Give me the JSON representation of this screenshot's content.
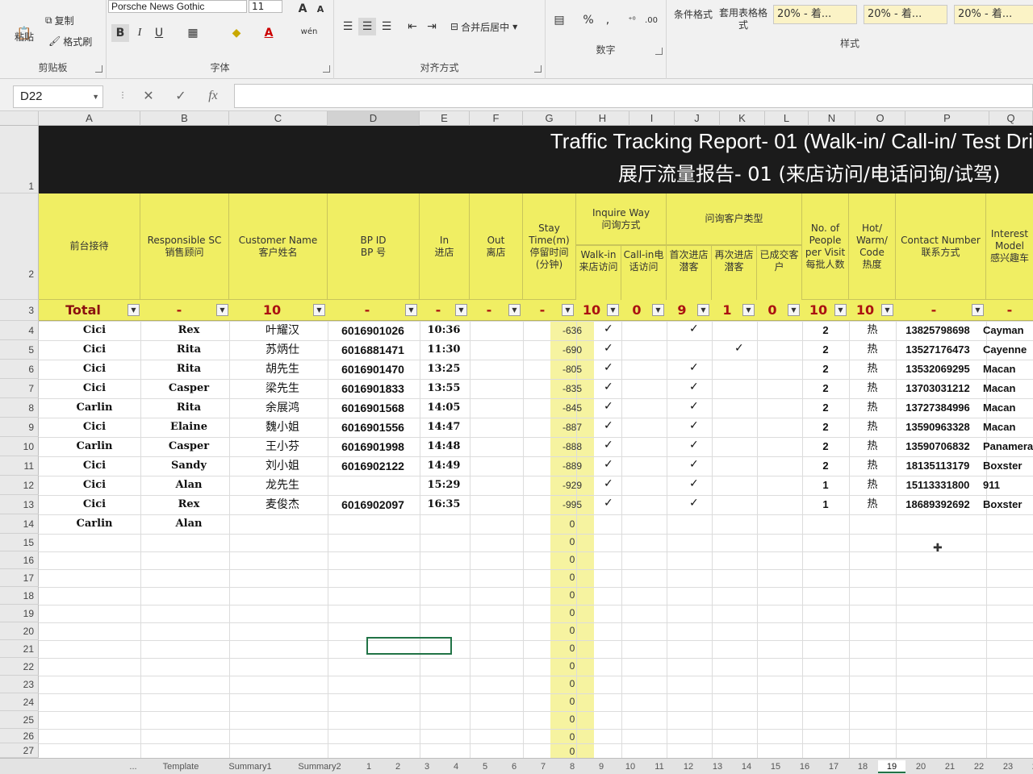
{
  "ribbon": {
    "clipboard": {
      "paste": "粘贴",
      "copy": "复制",
      "format_painter": "格式刷",
      "label": "剪贴板"
    },
    "font": {
      "name": "Porsche News Gothic",
      "size": "11",
      "label": "字体",
      "bold": "B",
      "italic": "I",
      "underline": "U",
      "font_color": "A",
      "phonetic": "wén"
    },
    "alignment": {
      "merge_center": "合并后居中",
      "label": "对齐方式"
    },
    "number": {
      "label": "数字",
      "percent": "%",
      "comma": ","
    },
    "styles": {
      "conditional": "条件格式",
      "table_format": "套用表格格式",
      "label": "样式",
      "swatches": [
        "20% - 着...",
        "20% - 着...",
        "20% - 着..."
      ]
    }
  },
  "formula_bar": {
    "name_box": "D22",
    "cancel": "✕",
    "enter": "✓",
    "fx": "fx",
    "value": ""
  },
  "columns": [
    "A",
    "B",
    "C",
    "D",
    "E",
    "F",
    "G",
    "H",
    "I",
    "J",
    "K",
    "L",
    "N",
    "O",
    "P",
    "Q"
  ],
  "row_numbers": [
    "1",
    "2",
    "3",
    "4",
    "5",
    "6",
    "7",
    "8",
    "9",
    "10",
    "11",
    "12",
    "13",
    "14",
    "15",
    "16",
    "17",
    "18",
    "19",
    "20",
    "21",
    "22",
    "23",
    "24",
    "25",
    "26",
    "27"
  ],
  "report": {
    "title_en": "Traffic Tracking Report- 01 (Walk-in/ Call-in/ Test Dri",
    "title_cn": "展厅流量报告- 01 (来店访问/电话问询/试驾)"
  },
  "headers": {
    "reception": "前台接待",
    "sc_en": "Responsible SC",
    "sc_cn": "销售顾问",
    "customer_en": "Customer Name",
    "customer_cn": "客户姓名",
    "bp_en": "BP ID",
    "bp_cn": "BP 号",
    "in_en": "In",
    "in_cn": "进店",
    "out_en": "Out",
    "out_cn": "离店",
    "stay_en": "Stay Time(m)",
    "stay_cn": "停留时间 (分钟)",
    "inquire_en": "Inquire Way",
    "inquire_cn": "问询方式",
    "walkin": "Walk-in 来店访问",
    "callin": "Call-in电话访问",
    "type_cn": "问询客户类型",
    "first_visit": "首次进店潜客",
    "revisit": "再次进店潜客",
    "closed": "已成交客户",
    "people_en": "No. of People per Visit",
    "people_cn": "每批人数",
    "hot_en": "Hot/ Warm/ Code",
    "hot_cn": "热度",
    "contact_en": "Contact Number",
    "contact_cn": "联系方式",
    "interest_en": "Interest Model",
    "interest_cn": "感兴趣车"
  },
  "filters": {
    "total": "Total",
    "b": "-",
    "c": "10",
    "d": "-",
    "e": "-",
    "f": "-",
    "g": "-",
    "h": "10",
    "i": "0",
    "j": "9",
    "k": "1",
    "l": "0",
    "n": "10",
    "o": "10",
    "p": "-",
    "q": "-"
  },
  "rows": [
    {
      "reception": "Cici",
      "sc": "Rex",
      "customer": "叶耀汉",
      "bp": "6016901026",
      "in": "10:36",
      "stay": "-636",
      "walkin": "✓",
      "first": "✓",
      "revisit": "",
      "people": "2",
      "hot": "热",
      "phone": "13825798698",
      "model": "Cayman"
    },
    {
      "reception": "Cici",
      "sc": "Rita",
      "customer": "苏炳仕",
      "bp": "6016881471",
      "in": "11:30",
      "stay": "-690",
      "walkin": "✓",
      "first": "",
      "revisit": "✓",
      "people": "2",
      "hot": "热",
      "phone": "13527176473",
      "model": "Cayenne"
    },
    {
      "reception": "Cici",
      "sc": "Rita",
      "customer": "胡先生",
      "bp": "6016901470",
      "in": "13:25",
      "stay": "-805",
      "walkin": "✓",
      "first": "✓",
      "revisit": "",
      "people": "2",
      "hot": "热",
      "phone": "13532069295",
      "model": "Macan"
    },
    {
      "reception": "Cici",
      "sc": "Casper",
      "customer": "梁先生",
      "bp": "6016901833",
      "in": "13:55",
      "stay": "-835",
      "walkin": "✓",
      "first": "✓",
      "revisit": "",
      "people": "2",
      "hot": "热",
      "phone": "13703031212",
      "model": "Macan"
    },
    {
      "reception": "Carlin",
      "sc": "Rita",
      "customer": "余展鸿",
      "bp": "6016901568",
      "in": "14:05",
      "stay": "-845",
      "walkin": "✓",
      "first": "✓",
      "revisit": "",
      "people": "2",
      "hot": "热",
      "phone": "13727384996",
      "model": "Macan"
    },
    {
      "reception": "Cici",
      "sc": "Elaine",
      "customer": "魏小姐",
      "bp": "6016901556",
      "in": "14:47",
      "stay": "-887",
      "walkin": "✓",
      "first": "✓",
      "revisit": "",
      "people": "2",
      "hot": "热",
      "phone": "13590963328",
      "model": "Macan"
    },
    {
      "reception": "Carlin",
      "sc": "Casper",
      "customer": "王小芬",
      "bp": "6016901998",
      "in": "14:48",
      "stay": "-888",
      "walkin": "✓",
      "first": "✓",
      "revisit": "",
      "people": "2",
      "hot": "热",
      "phone": "13590706832",
      "model": "Panamera"
    },
    {
      "reception": "Cici",
      "sc": "Sandy",
      "customer": "刘小姐",
      "bp": "6016902122",
      "in": "14:49",
      "stay": "-889",
      "walkin": "✓",
      "first": "✓",
      "revisit": "",
      "people": "2",
      "hot": "热",
      "phone": "18135113179",
      "model": "Boxster"
    },
    {
      "reception": "Cici",
      "sc": "Alan",
      "customer": "龙先生",
      "bp": "",
      "in": "15:29",
      "stay": "-929",
      "walkin": "✓",
      "first": "✓",
      "revisit": "",
      "people": "1",
      "hot": "热",
      "phone": "15113331800",
      "model": "911"
    },
    {
      "reception": "Cici",
      "sc": "Rex",
      "customer": "麦俊杰",
      "bp": "6016902097",
      "in": "16:35",
      "stay": "-995",
      "walkin": "✓",
      "first": "✓",
      "revisit": "",
      "people": "1",
      "hot": "热",
      "phone": "18689392692",
      "model": "Boxster"
    },
    {
      "reception": "Carlin",
      "sc": "Alan",
      "customer": "",
      "bp": "",
      "in": "",
      "stay": "0",
      "walkin": "",
      "first": "",
      "revisit": "",
      "people": "",
      "hot": "",
      "phone": "",
      "model": ""
    }
  ],
  "empty_stay": [
    "0",
    "0",
    "0",
    "0",
    "0",
    "0",
    "0",
    "0",
    "0",
    "0",
    "0",
    "0",
    "0"
  ],
  "tabs": [
    "...",
    "Template",
    "Summary1",
    "Summary2",
    "1",
    "2",
    "3",
    "4",
    "5",
    "6",
    "7",
    "8",
    "9",
    "10",
    "11",
    "12",
    "13",
    "14",
    "15",
    "16",
    "17",
    "18",
    "19",
    "20",
    "21",
    "22",
    "23",
    "24"
  ],
  "active_tab": "19"
}
